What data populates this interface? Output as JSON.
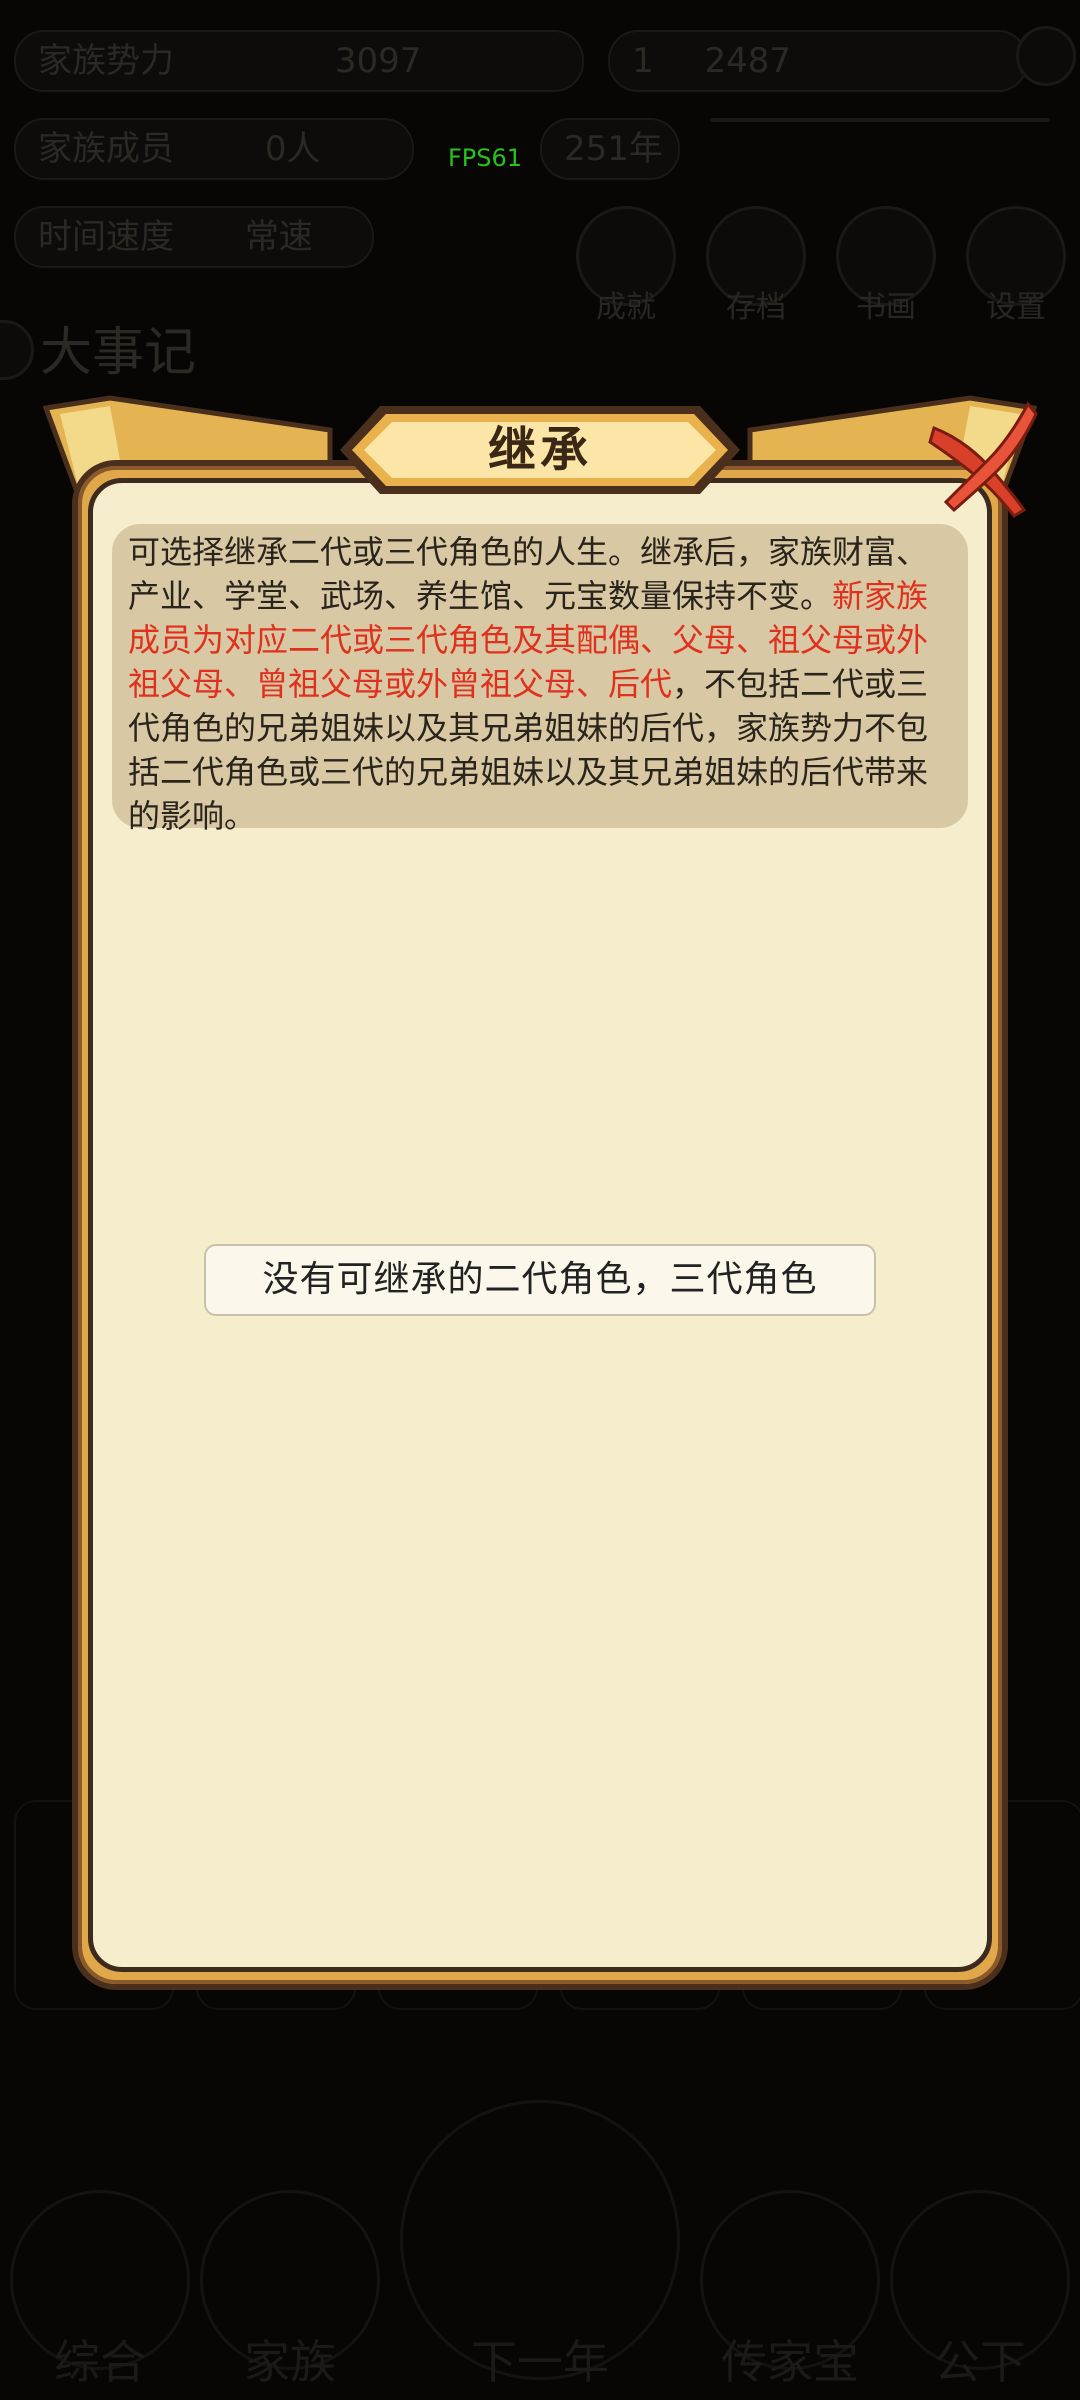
{
  "background": {
    "top_row": [
      {
        "label": "家族势力",
        "value": "3097"
      },
      {
        "label": "1",
        "value": "2487"
      }
    ],
    "second_row": [
      {
        "label": "家族成员",
        "value": "0人"
      },
      {
        "label": "",
        "value": "251年"
      }
    ],
    "third_row": [
      {
        "label": "时间速度",
        "value": "常速"
      }
    ],
    "top_icons": [
      {
        "label": "成就",
        "icon": "trophy-icon"
      },
      {
        "label": "存档",
        "icon": "save-icon"
      },
      {
        "label": "书画",
        "icon": "book-icon"
      },
      {
        "label": "设置",
        "icon": "gear-icon"
      }
    ],
    "section_title": "大事记",
    "fps": "FPS61",
    "bottom_nav": [
      {
        "label": "综合",
        "icon": "overview-icon"
      },
      {
        "label": "家族",
        "icon": "family-icon"
      },
      {
        "label": "下一年",
        "icon": "next-year-icon"
      },
      {
        "label": "传家宝",
        "icon": "heirloom-icon"
      },
      {
        "label": "公下",
        "icon": "more-icon"
      }
    ]
  },
  "dialog": {
    "title": "继承",
    "close_icon": "close-icon",
    "description_normal_1": "可选择继承二代或三代角色的人生。继承后，家族财富、产业、学堂、武场、养生馆、元宝数量保持不变。",
    "description_red": "新家族成员为对应二代或三代角色及其配偶、父母、祖父母或外祖父母、曾祖父母或外曾祖父母、后代",
    "description_normal_2": "，不包括二代或三代角色的兄弟姐妹以及其兄弟姐妹的后代，家族势力不包括二代角色或三代的兄弟姐妹以及其兄弟姐妹的后代带来的影响。",
    "empty_message": "没有可继承的二代角色，三代角色"
  },
  "colors": {
    "accent_red": "#e0301e",
    "parchment": "#f6edcd",
    "gold_frame": "#e0a84a"
  }
}
